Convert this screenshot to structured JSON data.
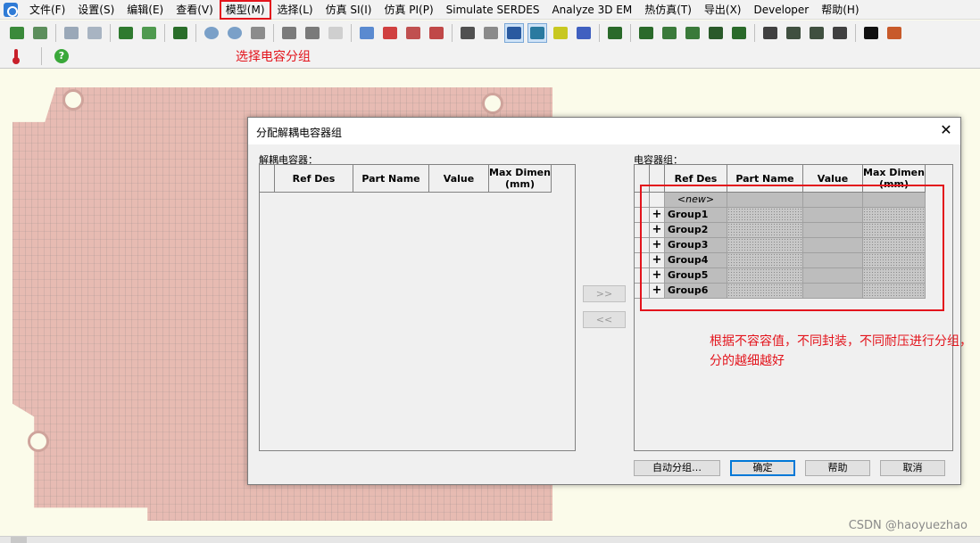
{
  "menu": [
    "文件(F)",
    "设置(S)",
    "编辑(E)",
    "查看(V)",
    "模型(M)",
    "选择(L)",
    "仿真 SI(I)",
    "仿真 PI(P)",
    "Simulate SERDES",
    "Analyze 3D EM",
    "热仿真(T)",
    "导出(X)",
    "Developer",
    "帮助(H)"
  ],
  "annotations": {
    "select_cap_group": "选择电容分组",
    "grouping_tip": "根据不容容值，不同封装，不同耐压进行分组，分的越细越好"
  },
  "dialog": {
    "title": "分配解耦电容器组",
    "left_label": "解耦电容器：",
    "right_label": "电容器组：",
    "columns": [
      "Ref Des",
      "Part Name",
      "Value",
      "Max Dimen (mm)"
    ],
    "new_row": "<new>",
    "groups": [
      "Group1",
      "Group2",
      "Group3",
      "Group4",
      "Group5",
      "Group6"
    ],
    "expand_symbol": "+",
    "move_right": ">>",
    "move_left": "<<",
    "buttons": {
      "auto_group": "自动分组…",
      "ok": "确定",
      "help": "帮助",
      "cancel": "取消"
    }
  },
  "watermark": "CSDN @haoyuezhao",
  "colors": {
    "highlight": "#e3141c",
    "accent": "#0078d7"
  }
}
